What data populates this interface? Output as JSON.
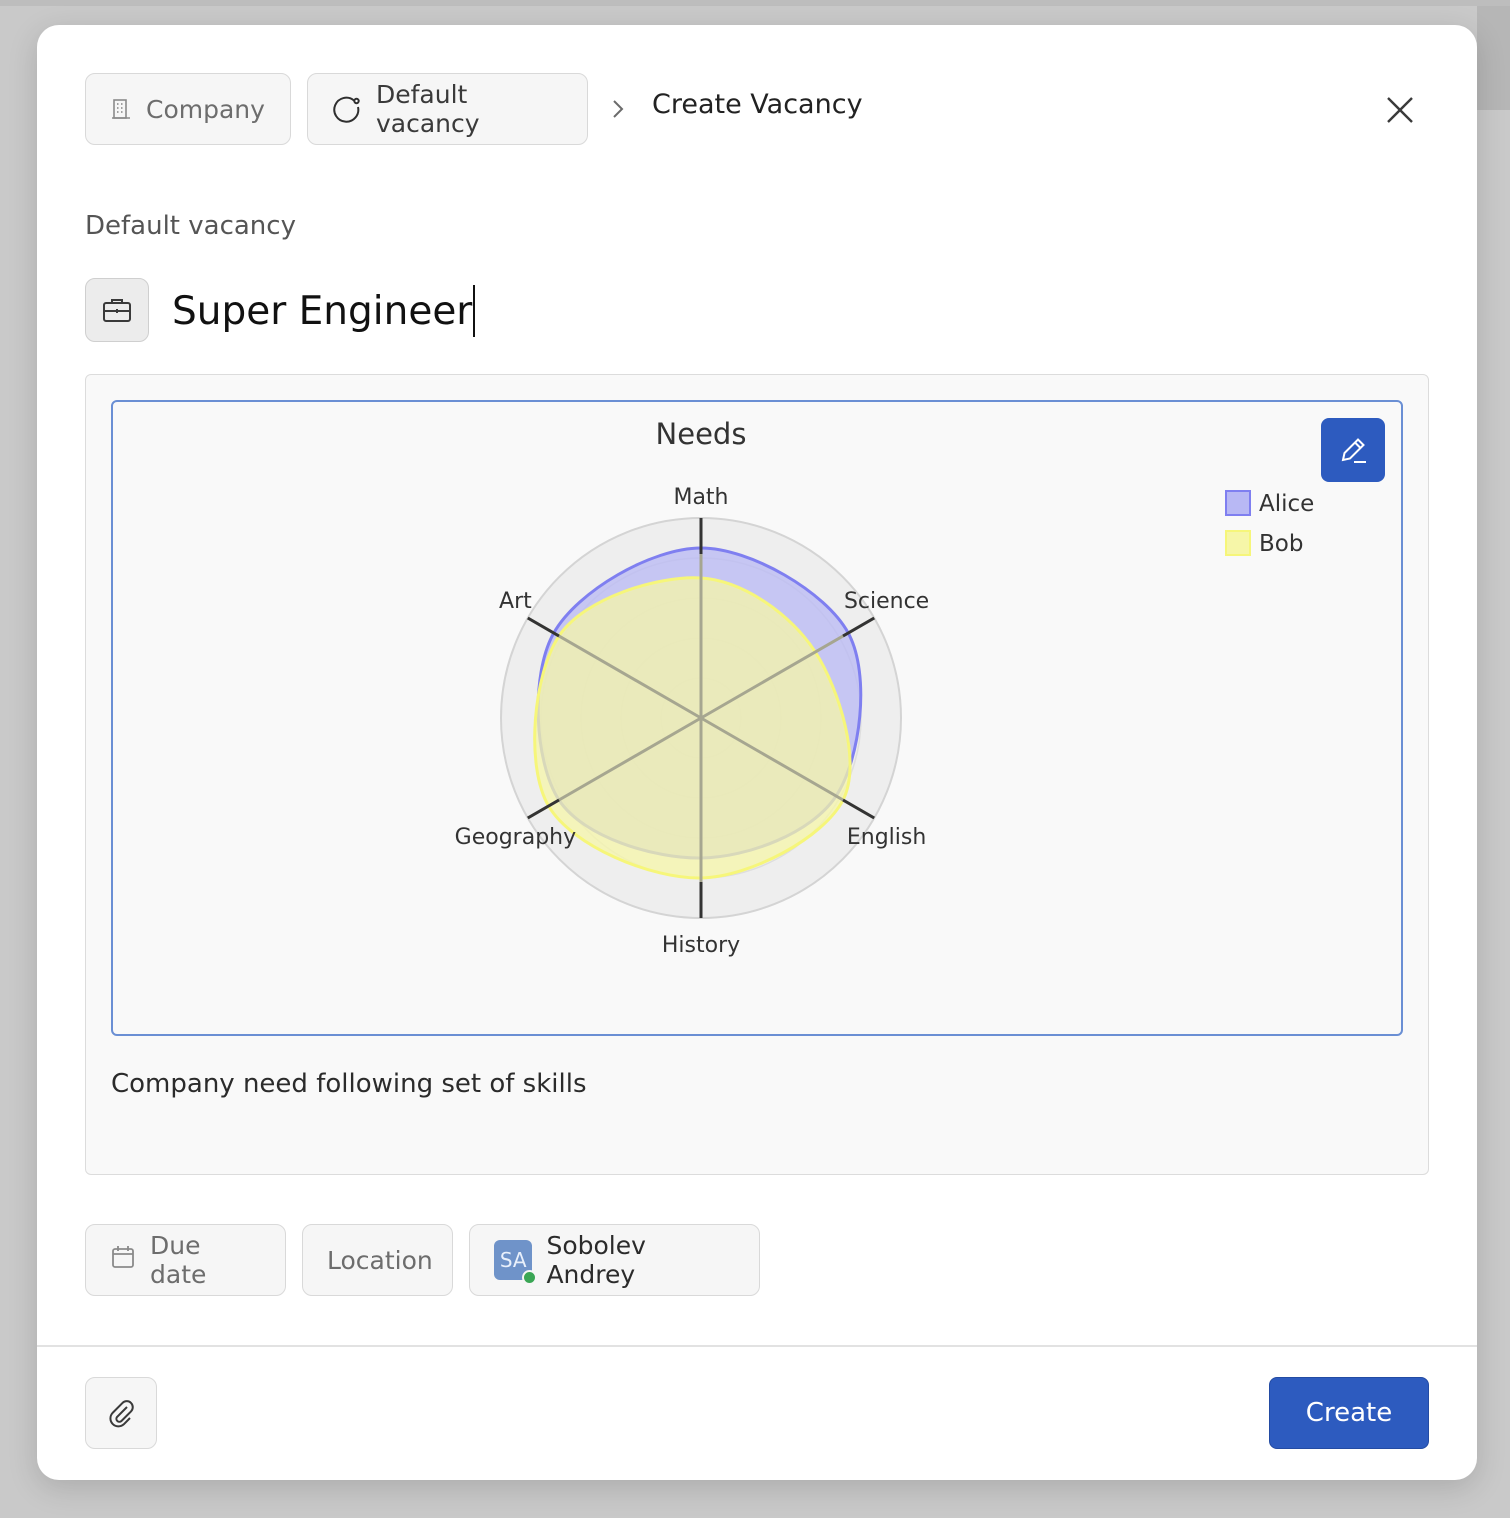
{
  "breadcrumb": {
    "company_label": "Company",
    "company_icon": "building-icon",
    "vacancy_label": "Default vacancy",
    "vacancy_icon": "circle-refresh-icon",
    "current_label": "Create Vacancy"
  },
  "form": {
    "section_label": "Default vacancy",
    "title_value": "Super Engineer",
    "description": "Company need following set of skills"
  },
  "chart_data": {
    "type": "radar",
    "title": "Needs",
    "categories": [
      "Math",
      "Science",
      "English",
      "History",
      "Geography",
      "Art"
    ],
    "rlim": [
      0,
      1
    ],
    "series": [
      {
        "name": "Alice",
        "values": [
          0.85,
          0.85,
          0.78,
          0.7,
          0.82,
          0.85
        ],
        "fill": "#b8b8f4",
        "stroke": "#7f7ff0"
      },
      {
        "name": "Bob",
        "values": [
          0.7,
          0.66,
          0.82,
          0.8,
          0.88,
          0.82
        ],
        "fill": "#f6f6a8",
        "stroke": "#f6f67a"
      }
    ],
    "legend_position": "top-right"
  },
  "attributes": {
    "due_date_label": "Due date",
    "location_label": "Location",
    "assignee_initials": "SA",
    "assignee_name": "Sobolev Andrey",
    "assignee_status": "online"
  },
  "footer": {
    "create_label": "Create"
  },
  "colors": {
    "accent": "#2d5bbf",
    "frame": "#6a8fd4"
  }
}
